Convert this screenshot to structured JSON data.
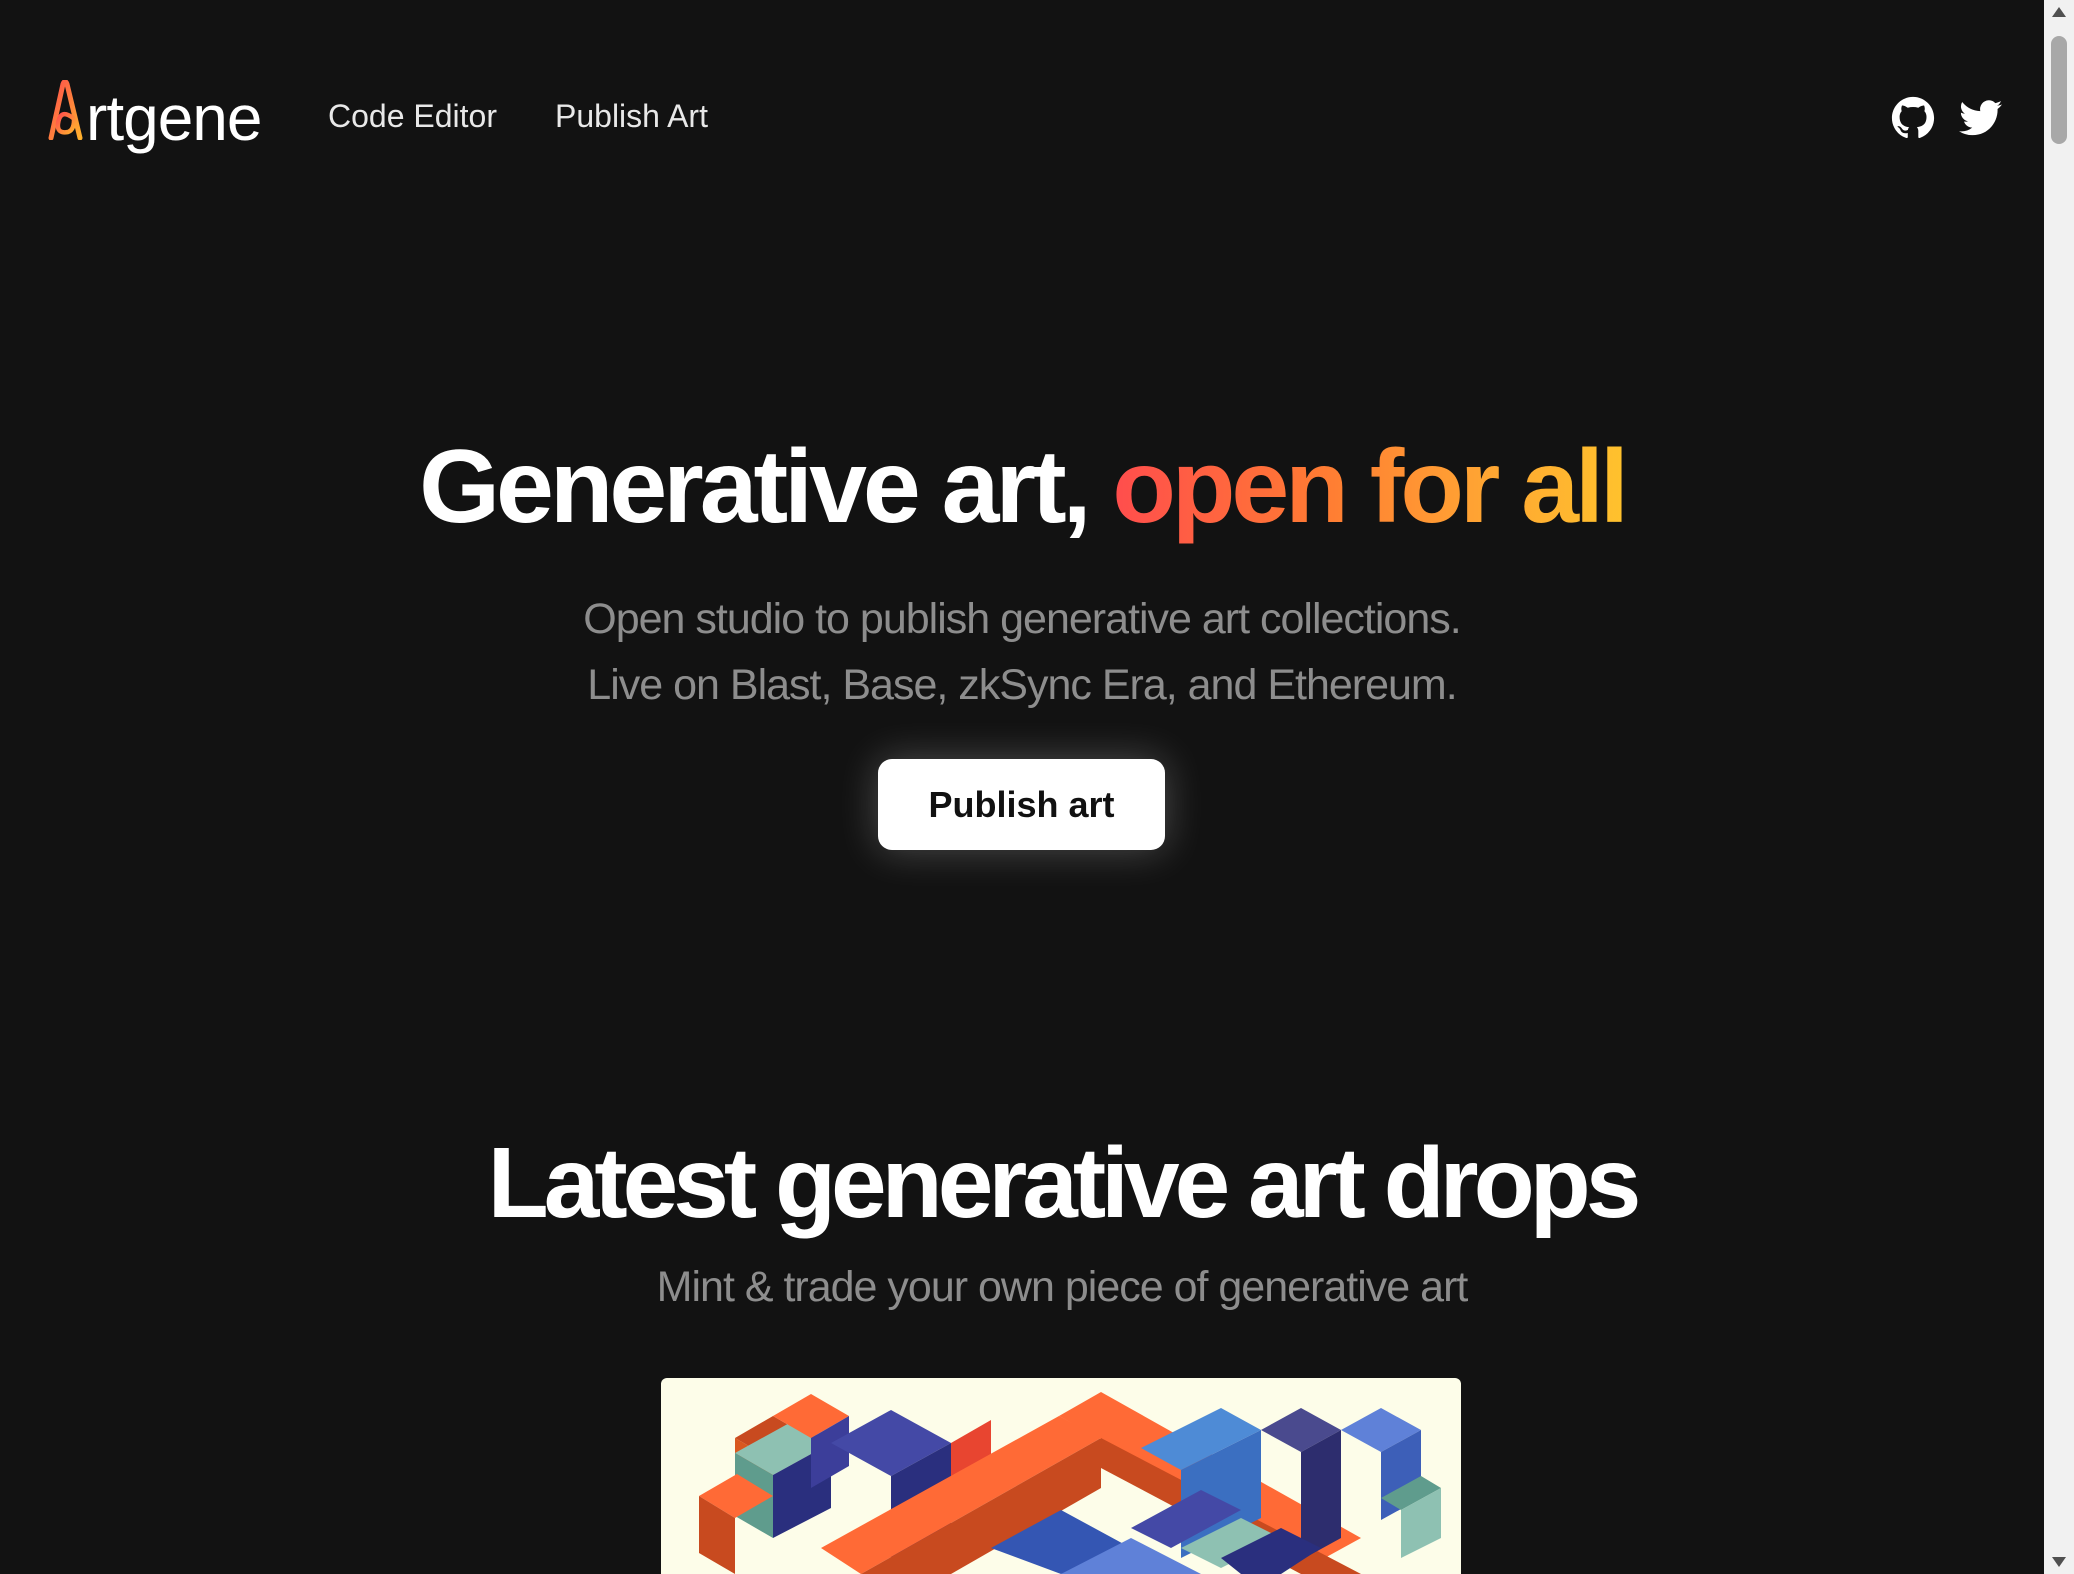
{
  "header": {
    "logo_text": "rtgene",
    "logo_icon": "artgene-a-logo",
    "nav": [
      {
        "label": "Code Editor"
      },
      {
        "label": "Publish Art"
      }
    ],
    "icons": [
      "github-icon",
      "twitter-icon"
    ]
  },
  "hero": {
    "title_plain": "Generative art, ",
    "title_accent": "open for all",
    "subtitle_line1": "Open studio to publish generative art collections.",
    "subtitle_line2": "Live on Blast, Base, zkSync Era, and Ethereum.",
    "cta_label": "Publish art"
  },
  "drops": {
    "title": "Latest generative art drops",
    "subtitle": "Mint & trade your own piece of generative art"
  },
  "colors": {
    "background": "#121212",
    "accent_gradient": [
      "#ff4d4d",
      "#ff7a33",
      "#ffa233",
      "#ffc22d"
    ],
    "subtitle": "#8d8d8d",
    "card_bg": "#fdfde9"
  }
}
